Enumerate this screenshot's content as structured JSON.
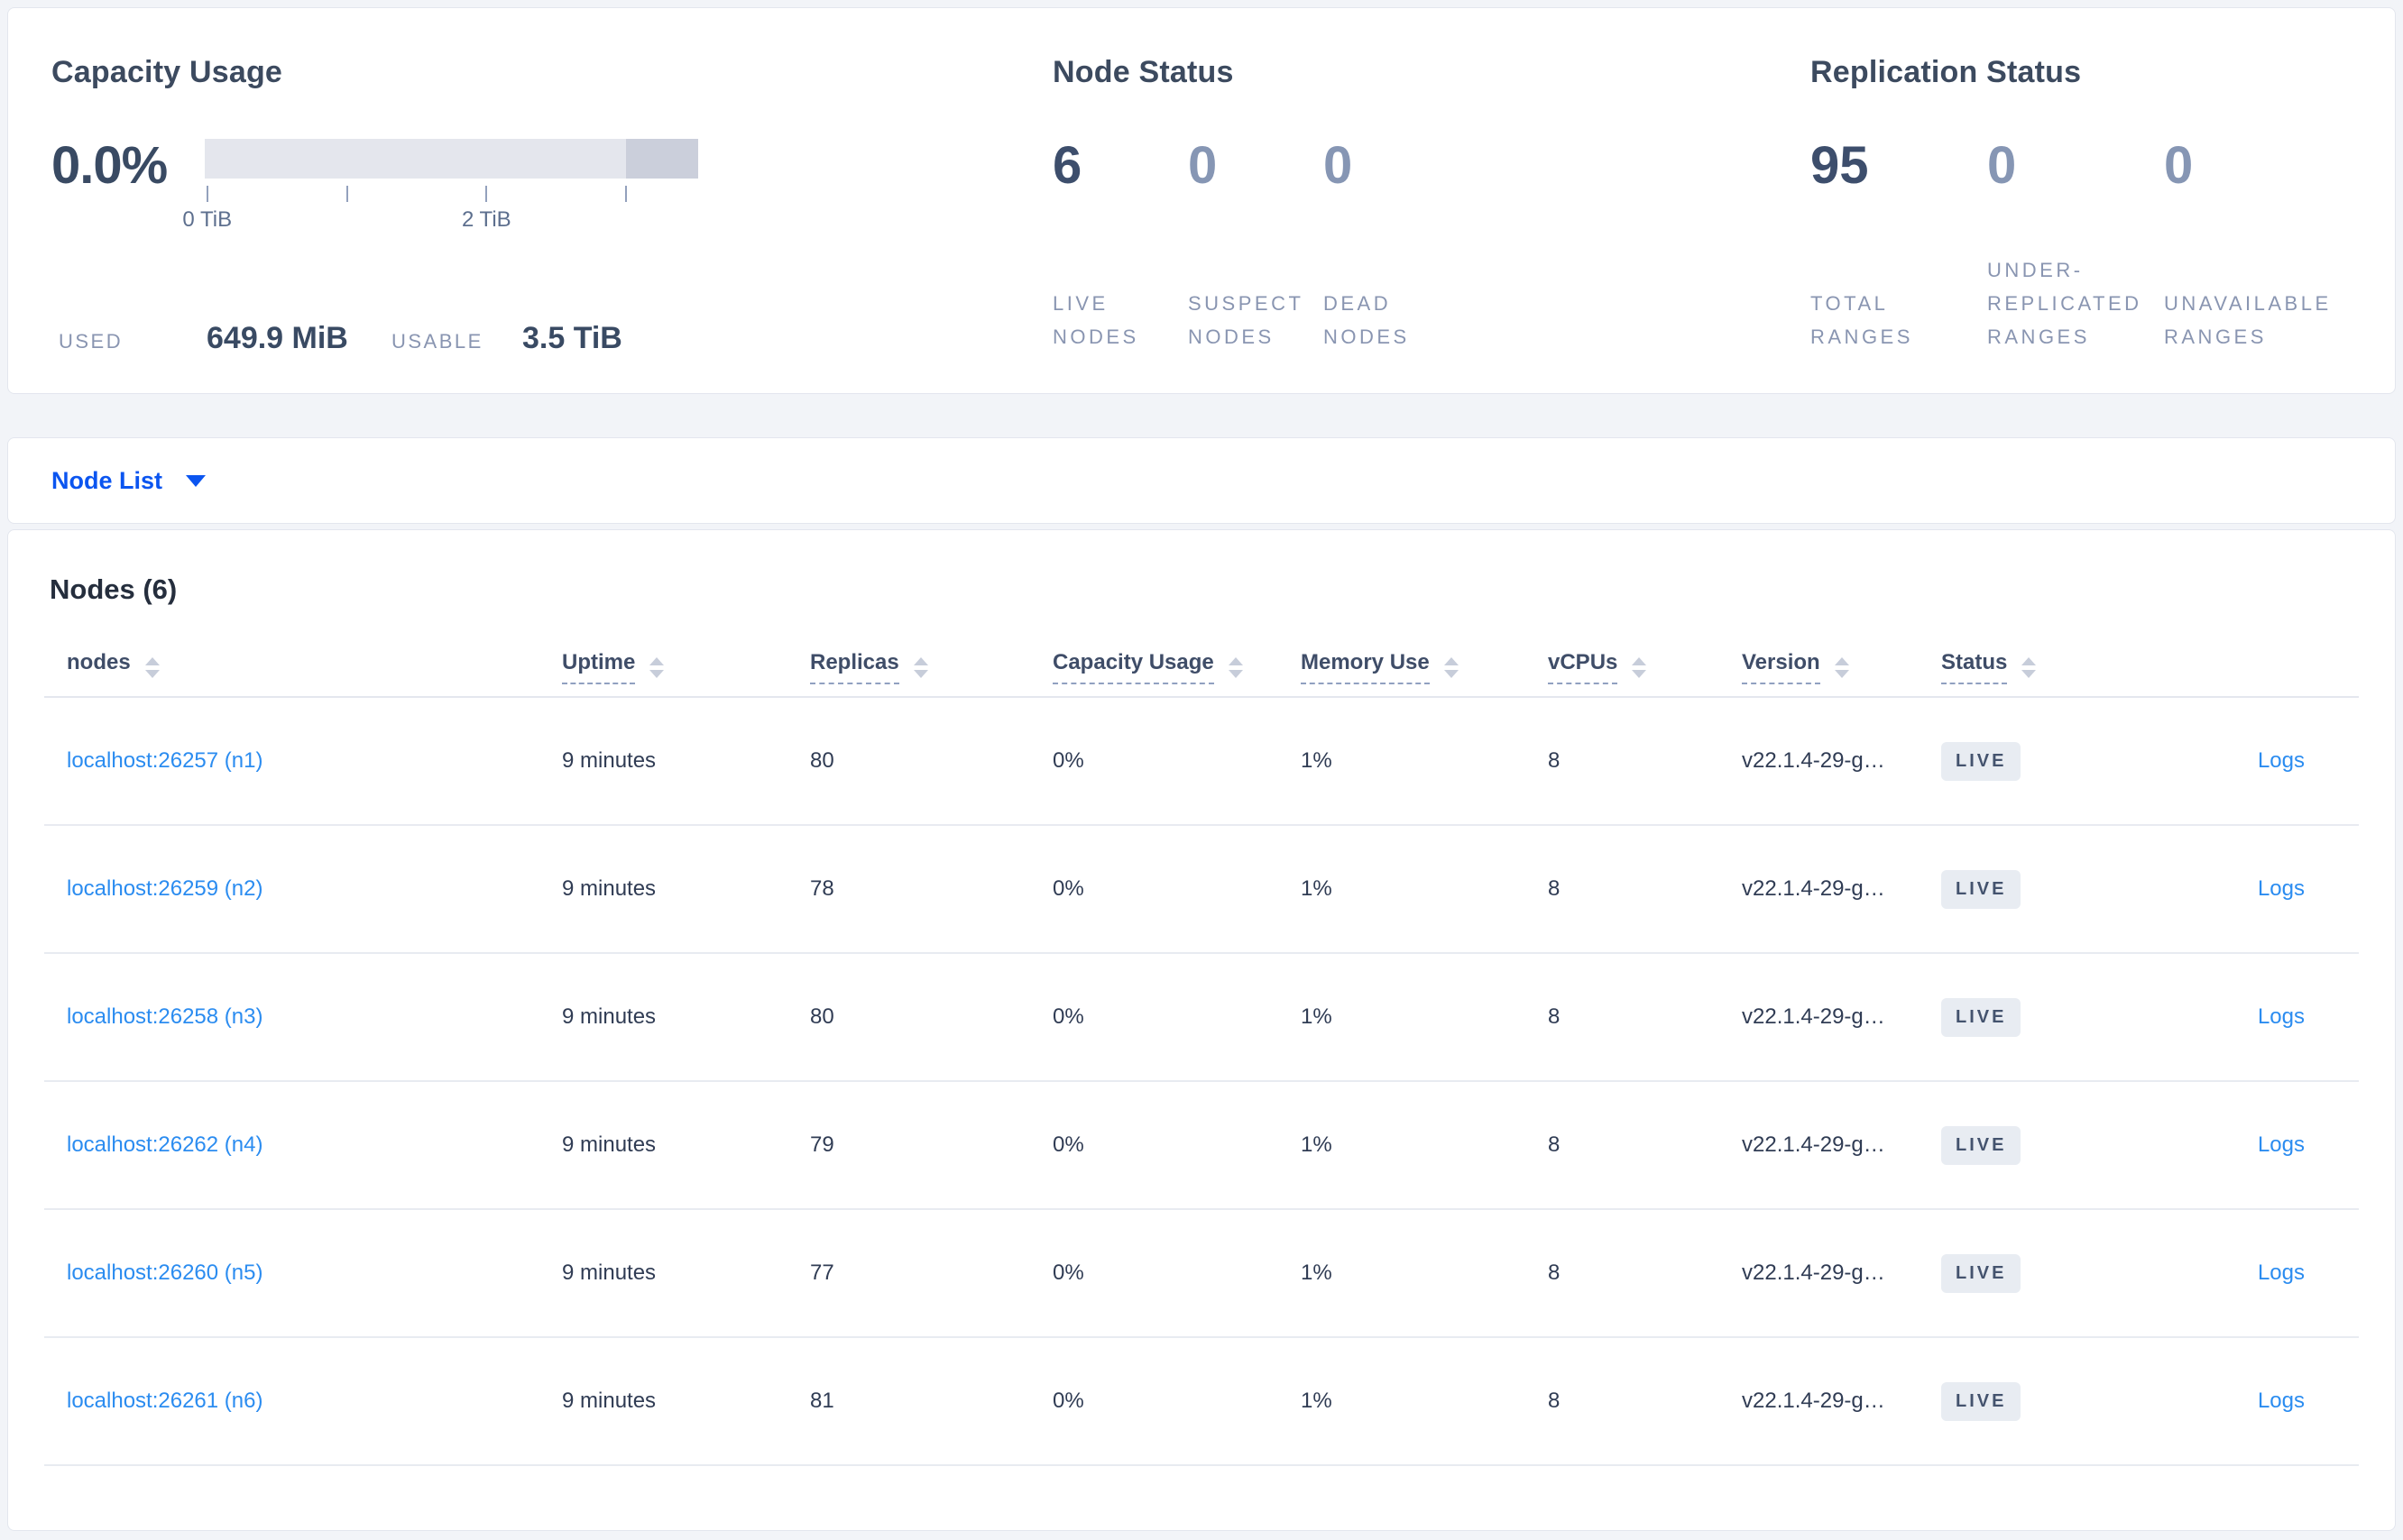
{
  "colors": {
    "accent_blue": "#0b55f0",
    "link_blue": "#2b8cf0",
    "heading_text": "#3c4a5f",
    "muted_stat_text": "#8696b4",
    "badge_bg": "#e8ecf2",
    "bar_light": "#e4e6ed",
    "bar_dark": "#cbcfdb"
  },
  "overview": {
    "capacity": {
      "title": "Capacity Usage",
      "percent": "0.0%",
      "bar": {
        "used_pct": 0,
        "reserved_start_pct": 85.3,
        "ticks": [
          {
            "pos_pct": 0.5,
            "label": "0 TiB"
          },
          {
            "pos_pct": 28.8,
            "label": ""
          },
          {
            "pos_pct": 57.1,
            "label": "2 TiB"
          },
          {
            "pos_pct": 85.3,
            "label": ""
          }
        ]
      },
      "used_label": "USED",
      "used_value": "649.9 MiB",
      "usable_label": "USABLE",
      "usable_value": "3.5 TiB"
    },
    "node_status": {
      "title": "Node Status",
      "stats": [
        {
          "value": "6",
          "muted": false,
          "label_lines": [
            "LIVE",
            "NODES"
          ]
        },
        {
          "value": "0",
          "muted": true,
          "label_lines": [
            "SUSPECT",
            "NODES"
          ]
        },
        {
          "value": "0",
          "muted": true,
          "label_lines": [
            "DEAD",
            "NODES"
          ]
        }
      ]
    },
    "replication_status": {
      "title": "Replication Status",
      "stats": [
        {
          "value": "95",
          "muted": false,
          "label_lines": [
            "TOTAL",
            "RANGES"
          ]
        },
        {
          "value": "0",
          "muted": true,
          "label_lines": [
            "UNDER-",
            "REPLICATED",
            "RANGES"
          ]
        },
        {
          "value": "0",
          "muted": true,
          "label_lines": [
            "UNAVAILABLE",
            "RANGES"
          ]
        }
      ]
    }
  },
  "view_selector": {
    "label": "Node List"
  },
  "nodes_section": {
    "title": "Nodes (6)",
    "columns": [
      {
        "key": "node",
        "label": "nodes",
        "tooltip": false
      },
      {
        "key": "uptime",
        "label": "Uptime",
        "tooltip": true
      },
      {
        "key": "replicas",
        "label": "Replicas",
        "tooltip": true
      },
      {
        "key": "capacity",
        "label": "Capacity Usage",
        "tooltip": true
      },
      {
        "key": "memory",
        "label": "Memory Use",
        "tooltip": true
      },
      {
        "key": "vcpus",
        "label": "vCPUs",
        "tooltip": true
      },
      {
        "key": "version",
        "label": "Version",
        "tooltip": true
      },
      {
        "key": "status",
        "label": "Status",
        "tooltip": true
      }
    ],
    "rows": [
      {
        "node": "localhost:26257 (n1)",
        "uptime": "9 minutes",
        "replicas": "80",
        "capacity": "0%",
        "memory": "1%",
        "vcpus": "8",
        "version": "v22.1.4-29-g…",
        "status": "LIVE",
        "logs": "Logs"
      },
      {
        "node": "localhost:26259 (n2)",
        "uptime": "9 minutes",
        "replicas": "78",
        "capacity": "0%",
        "memory": "1%",
        "vcpus": "8",
        "version": "v22.1.4-29-g…",
        "status": "LIVE",
        "logs": "Logs"
      },
      {
        "node": "localhost:26258 (n3)",
        "uptime": "9 minutes",
        "replicas": "80",
        "capacity": "0%",
        "memory": "1%",
        "vcpus": "8",
        "version": "v22.1.4-29-g…",
        "status": "LIVE",
        "logs": "Logs"
      },
      {
        "node": "localhost:26262 (n4)",
        "uptime": "9 minutes",
        "replicas": "79",
        "capacity": "0%",
        "memory": "1%",
        "vcpus": "8",
        "version": "v22.1.4-29-g…",
        "status": "LIVE",
        "logs": "Logs"
      },
      {
        "node": "localhost:26260 (n5)",
        "uptime": "9 minutes",
        "replicas": "77",
        "capacity": "0%",
        "memory": "1%",
        "vcpus": "8",
        "version": "v22.1.4-29-g…",
        "status": "LIVE",
        "logs": "Logs"
      },
      {
        "node": "localhost:26261 (n6)",
        "uptime": "9 minutes",
        "replicas": "81",
        "capacity": "0%",
        "memory": "1%",
        "vcpus": "8",
        "version": "v22.1.4-29-g…",
        "status": "LIVE",
        "logs": "Logs"
      }
    ]
  }
}
